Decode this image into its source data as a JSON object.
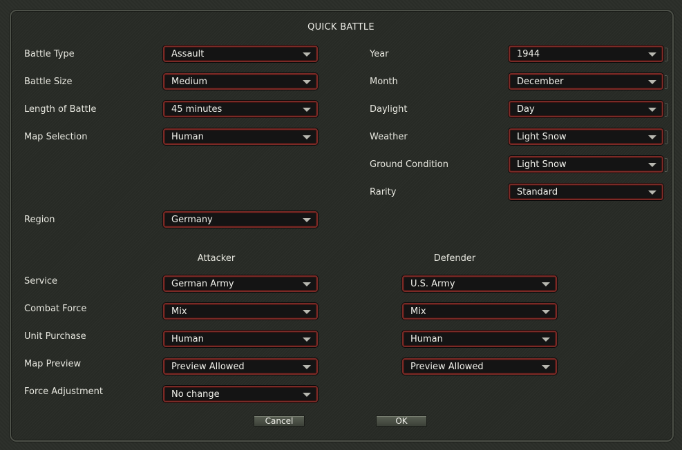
{
  "title": "QUICK BATTLE",
  "left_fields": [
    {
      "label": "Battle Type",
      "value": "Assault"
    },
    {
      "label": "Battle Size",
      "value": "Medium"
    },
    {
      "label": "Length of Battle",
      "value": "45 minutes"
    },
    {
      "label": "Map Selection",
      "value": "Human"
    },
    {
      "label": "Region",
      "value": "Germany"
    }
  ],
  "right_fields": [
    {
      "label": "Year",
      "value": "1944"
    },
    {
      "label": "Month",
      "value": "December"
    },
    {
      "label": "Daylight",
      "value": "Day"
    },
    {
      "label": "Weather",
      "value": "Light Snow"
    },
    {
      "label": "Ground Condition",
      "value": "Light Snow"
    },
    {
      "label": "Rarity",
      "value": "Standard"
    }
  ],
  "headers": {
    "attacker": "Attacker",
    "defender": "Defender"
  },
  "force_rows": [
    {
      "label": "Service",
      "attacker": "German Army",
      "defender": "U.S. Army"
    },
    {
      "label": "Combat Force",
      "attacker": "Mix",
      "defender": "Mix"
    },
    {
      "label": "Unit Purchase",
      "attacker": "Human",
      "defender": "Human"
    },
    {
      "label": "Map Preview",
      "attacker": "Preview Allowed",
      "defender": "Preview Allowed"
    },
    {
      "label": "Force Adjustment",
      "attacker": "No change"
    }
  ],
  "buttons": {
    "cancel": "Cancel",
    "ok": "OK"
  },
  "colors": {
    "dropdown_border": "#7a2a26",
    "background": "#2b2e29",
    "button": "#4a5045"
  }
}
